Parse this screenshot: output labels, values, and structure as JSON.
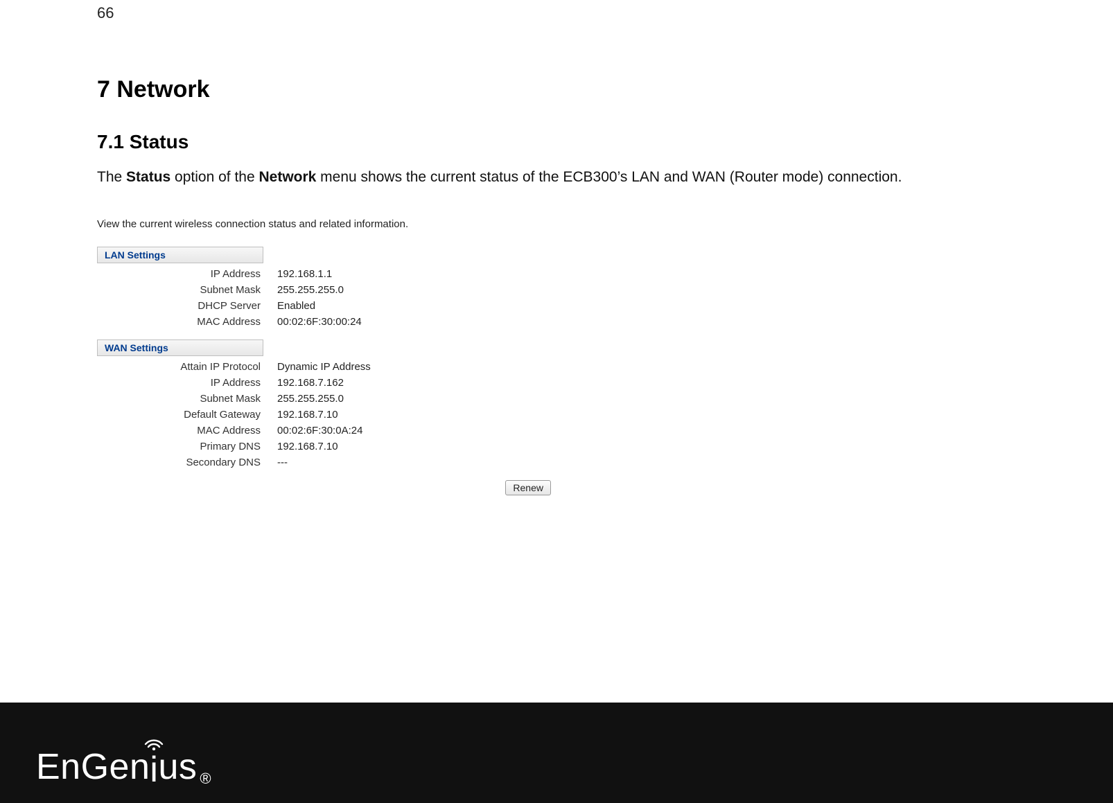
{
  "page_number": "66",
  "heading_chapter": "7   Network",
  "heading_section": "7.1   Status",
  "paragraph_leading": "The ",
  "paragraph_bold1": "Status",
  "paragraph_mid1": " option of the ",
  "paragraph_bold2": "Network",
  "paragraph_trailing": " menu shows the current status of the ECB300’s LAN and WAN (Router mode) connection.",
  "screenshot": {
    "caption": "View the current wireless connection status and related information.",
    "lan_header": "LAN Settings",
    "lan": {
      "ip_address_label": "IP Address",
      "ip_address_value": "192.168.1.1",
      "subnet_mask_label": "Subnet Mask",
      "subnet_mask_value": "255.255.255.0",
      "dhcp_server_label": "DHCP Server",
      "dhcp_server_value": "Enabled",
      "mac_address_label": "MAC Address",
      "mac_address_value": "00:02:6F:30:00:24"
    },
    "wan_header": "WAN Settings",
    "wan": {
      "attain_ip_label": "Attain IP Protocol",
      "attain_ip_value": "Dynamic IP Address",
      "ip_address_label": "IP Address",
      "ip_address_value": "192.168.7.162",
      "subnet_mask_label": "Subnet Mask",
      "subnet_mask_value": "255.255.255.0",
      "default_gw_label": "Default Gateway",
      "default_gw_value": "192.168.7.10",
      "mac_address_label": "MAC Address",
      "mac_address_value": "00:02:6F:30:0A:24",
      "primary_dns_label": "Primary DNS",
      "primary_dns_value": "192.168.7.10",
      "secondary_dns_label": "Secondary DNS",
      "secondary_dns_value": "---"
    },
    "renew_button": "Renew"
  },
  "logo": {
    "part1": "En",
    "part2": "Gen",
    "part3_i": "i",
    "part4": "us",
    "reg": "®"
  }
}
